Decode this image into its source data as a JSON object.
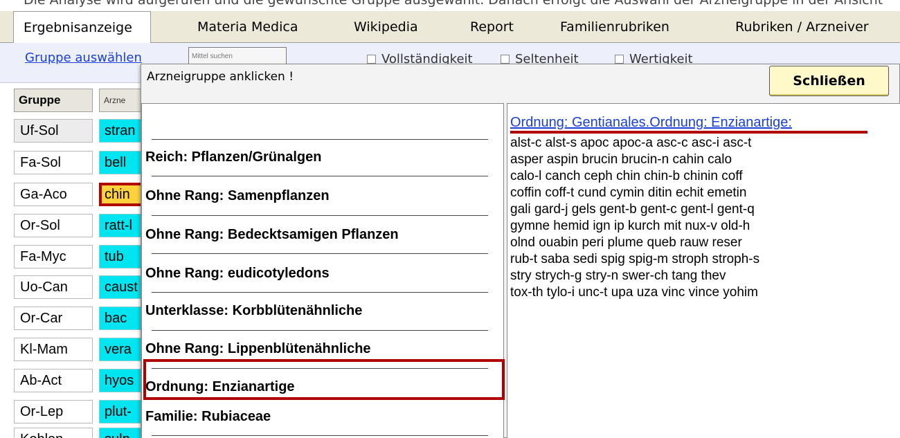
{
  "top_caption": "Die Analyse wird aufgerufen und die gewünschte Gruppe ausgewählt. Danach erfolgt die Auswahl der Arzneigruppe in der Ansicht",
  "tabs": [
    {
      "label": "Ergebnisanzeige",
      "active": true
    },
    {
      "label": "Materia Medica"
    },
    {
      "label": "Wikipedia"
    },
    {
      "label": "Report"
    },
    {
      "label": "Familienrubriken"
    },
    {
      "label": "Rubriken / Arzneiver"
    }
  ],
  "toolbar": {
    "group_link": "Gruppe auswählen",
    "search_placeholder": "Mittel suchen",
    "checkboxes": [
      "Vollständigkeit",
      "Seltenheit",
      "Wertigkeit"
    ]
  },
  "left_table": {
    "header_group": "Gruppe",
    "header_remedy": "Arzne",
    "rows": [
      {
        "group": "Uf-Sol",
        "remedy": "stran"
      },
      {
        "group": "Fa-Sol",
        "remedy": "bell"
      },
      {
        "group": "Ga-Aco",
        "remedy": "chin",
        "selected": true
      },
      {
        "group": "Or-Sol",
        "remedy": "ratt-l"
      },
      {
        "group": "Fa-Myc",
        "remedy": "tub"
      },
      {
        "group": "Uo-Can",
        "remedy": "caust"
      },
      {
        "group": "Or-Car",
        "remedy": "bac"
      },
      {
        "group": "Kl-Mam",
        "remedy": "vera"
      },
      {
        "group": "Ab-Act",
        "remedy": "hyos"
      },
      {
        "group": "Or-Lep",
        "remedy": "plut-"
      },
      {
        "group": "Kohlen",
        "remedy": "sulp"
      }
    ]
  },
  "popup": {
    "title": "Arzneigruppe anklicken !",
    "close_label": "Schließen",
    "items": [
      "Reich: Pflanzen/Grünalgen",
      "Ohne Rang: Samenpflanzen",
      "Ohne Rang: Bedecktsamigen Pflanzen",
      "Ohne Rang: eudicotyledons",
      "Unterklasse: Korbblütenähnliche",
      "Ohne Rang: Lippenblütenähnliche",
      "Ordnung: Enzianartige",
      "Familie: Rubiaceae"
    ],
    "selected_item": "Ordnung: Enzianartige",
    "detail_title": "Ordnung: Gentianales.Ordnung: Enzianartige:",
    "detail_lines": [
      "alst-c  alst-s  apoc  apoc-a  asc-c  asc-i  asc-t",
      " asper  aspin  brucin  brucin-n  cahin  calo",
      "calo-l  canch  ceph  chin  chin-b  chinin  coff",
      "coffin  coff-t  cund  cymin  ditin  echit  emetin",
      "gali  gard-j  gels  gent-b  gent-c  gent-l  gent-q",
      "gymne  hemid  ign  ip  kurch  mit  nux-v  old-h",
      "olnd  ouabin  peri  plume  queb  rauw  reser",
      "rub-t  saba  sedi  spig  spig-m  stroph  stroph-s",
      " stry  strych-g  stry-n  swer-ch  tang  thev",
      "tox-th  tylo-i  unc-t  upa  uza  vinc  vince  yohim"
    ]
  },
  "colors": {
    "accent_red": "#b10000",
    "remedy_cell": "#00e5f0",
    "selected_cell": "#ffd23d",
    "link_blue": "#1a3fd6",
    "close_button": "#fff9c9"
  }
}
